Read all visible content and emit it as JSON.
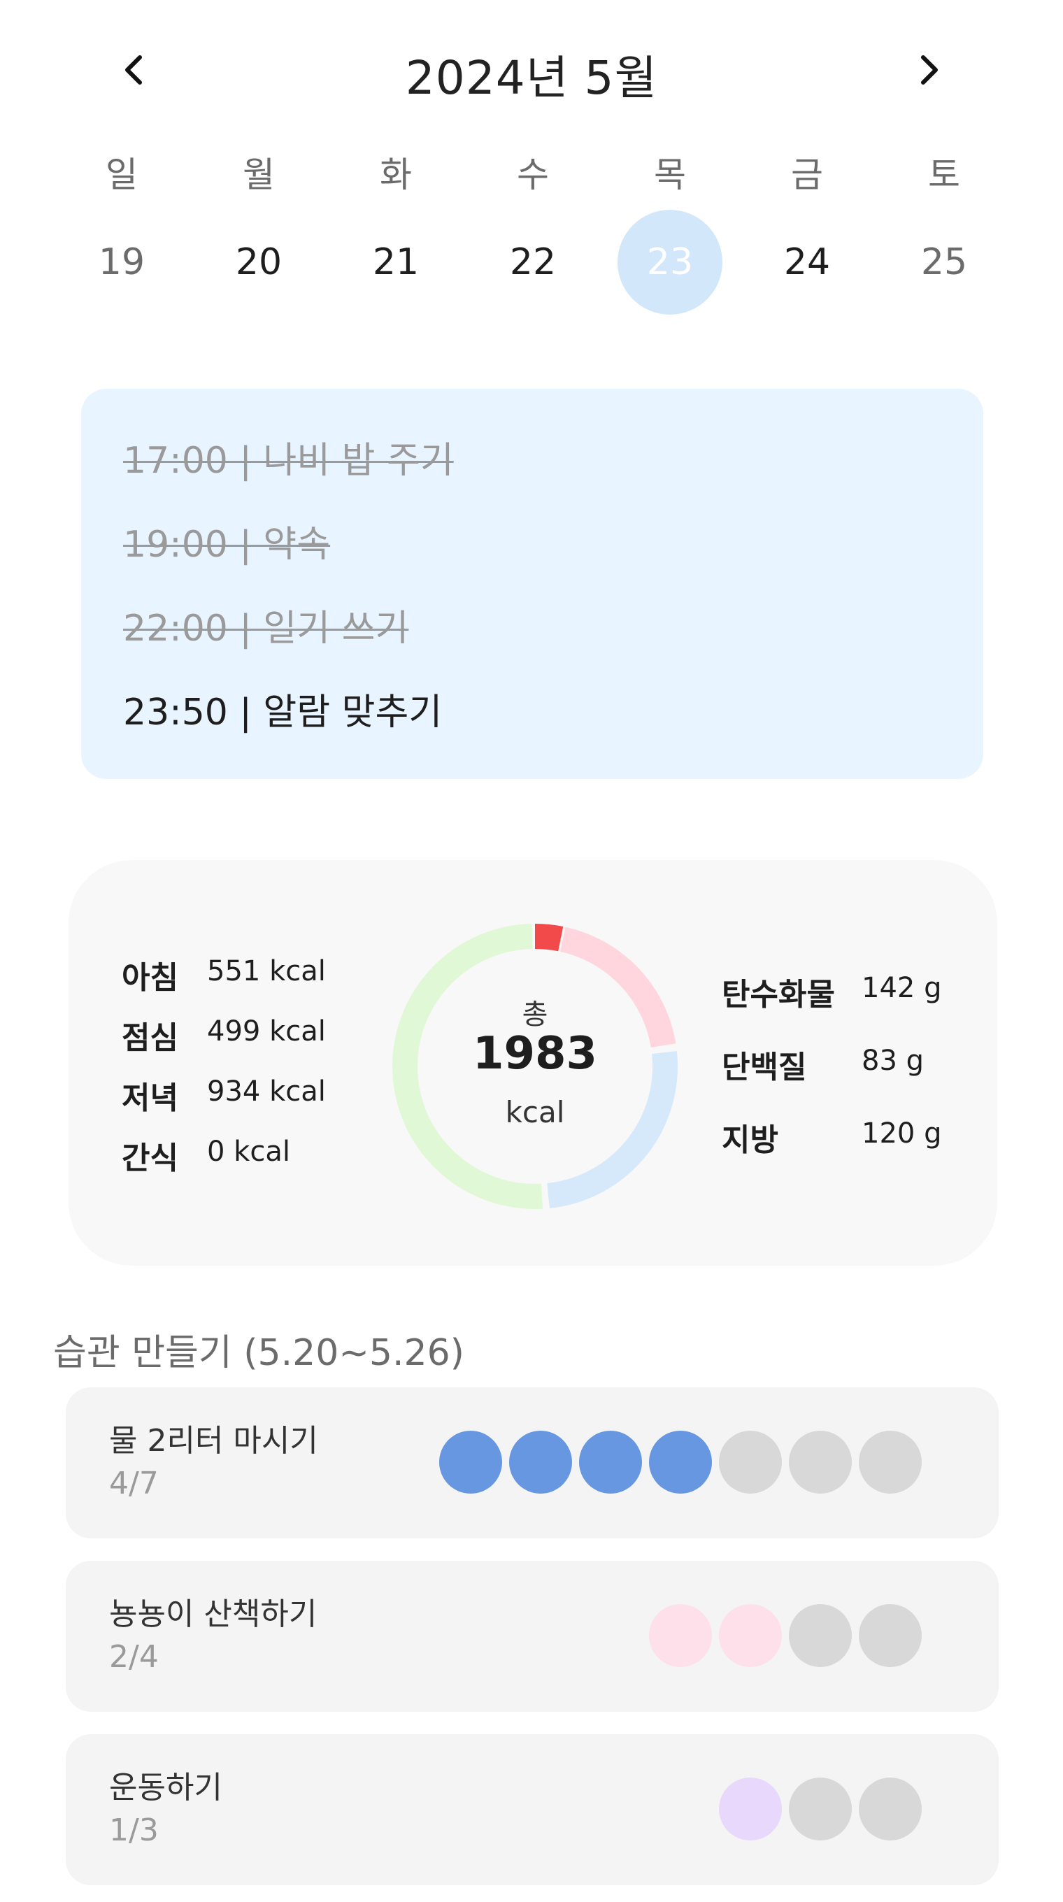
{
  "calendar": {
    "title": "2024년 5월",
    "prev_icon": "chevron-left-icon",
    "next_icon": "chevron-right-icon",
    "weekdays": [
      "일",
      "월",
      "화",
      "수",
      "목",
      "금",
      "토"
    ],
    "dates": [
      "19",
      "20",
      "21",
      "22",
      "23",
      "24",
      "25"
    ],
    "selected_date": "23",
    "selected_color": "#d3e7fb"
  },
  "todos": [
    {
      "text": "17:00 | 나비 밥 주기",
      "done": true
    },
    {
      "text": "19:00 | 약속",
      "done": true
    },
    {
      "text": "22:00 | 일기 쓰기",
      "done": true
    },
    {
      "text": "23:50 | 알람 맞추기",
      "done": false
    }
  ],
  "calories": {
    "meals": [
      {
        "name": "아침",
        "value": "551 kcal"
      },
      {
        "name": "점심",
        "value": "499 kcal"
      },
      {
        "name": "저녁",
        "value": "934 kcal"
      },
      {
        "name": "간식",
        "value": "0 kcal"
      }
    ],
    "total_label": "총",
    "total_value": "1983",
    "total_unit": "kcal",
    "nutrients": [
      {
        "name": "탄수화물",
        "value": "142 g"
      },
      {
        "name": "단백질",
        "value": "83 g"
      },
      {
        "name": "지방",
        "value": "120 g"
      }
    ],
    "donut_colors": {
      "over": "#f24a4a",
      "pink": "#ffd6dd",
      "blue": "#d6e9fb",
      "green": "#e1f8d6"
    }
  },
  "habits": {
    "title": "습관 만들기 (5.20~5.26)",
    "items": [
      {
        "name": "물 2리터 마시기",
        "progress": "4/7",
        "done": 4,
        "total": 7,
        "color": "#6797e0"
      },
      {
        "name": "뇽뇽이 산책하기",
        "progress": "2/4",
        "done": 2,
        "total": 4,
        "color": "#fde0ea"
      },
      {
        "name": "운동하기",
        "progress": "1/3",
        "done": 1,
        "total": 3,
        "color": "#e8d8fb"
      }
    ],
    "empty_color": "#d8d8d8"
  }
}
